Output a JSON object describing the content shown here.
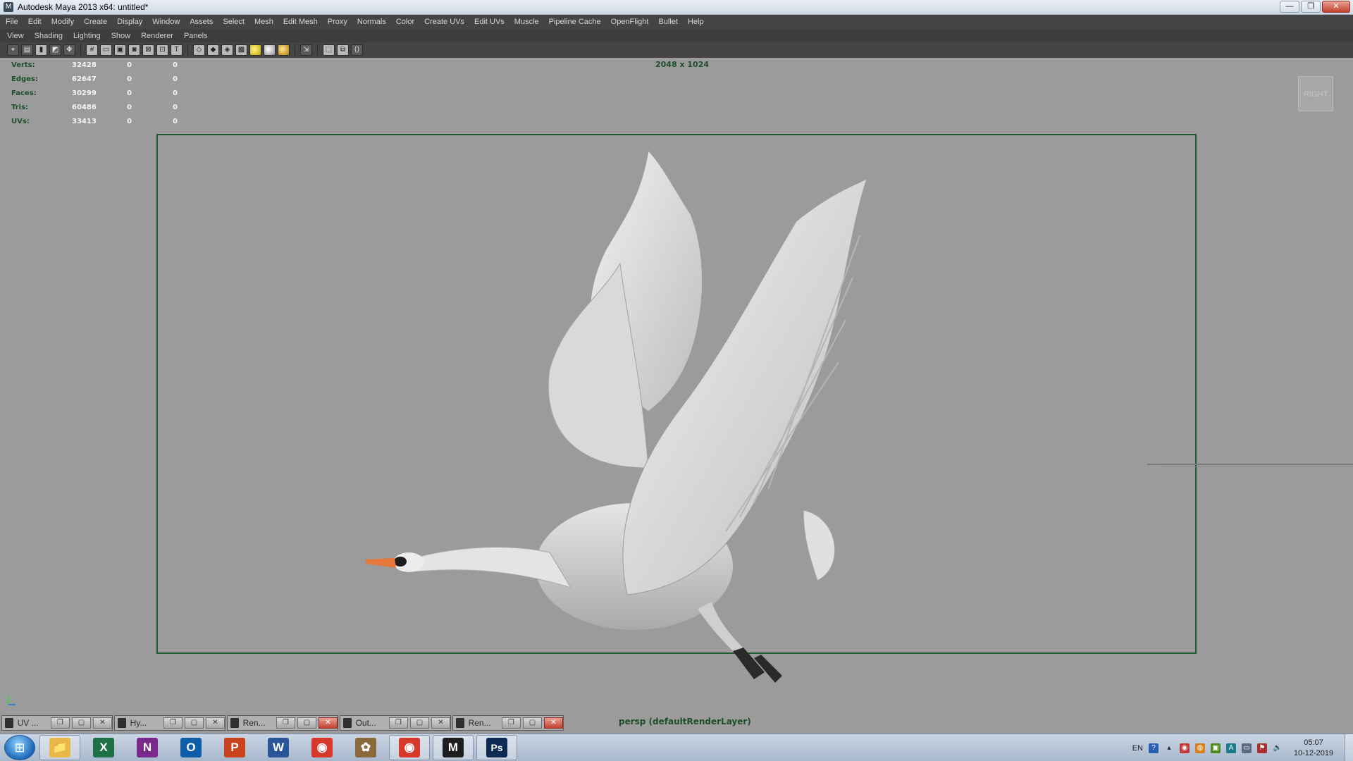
{
  "window": {
    "title": "Autodesk Maya 2013 x64: untitled*",
    "controls": {
      "minimize": "—",
      "restore": "❐",
      "close": "✕"
    }
  },
  "menubar": [
    "File",
    "Edit",
    "Modify",
    "Create",
    "Display",
    "Window",
    "Assets",
    "Select",
    "Mesh",
    "Edit Mesh",
    "Proxy",
    "Normals",
    "Color",
    "Create UVs",
    "Edit UVs",
    "Muscle",
    "Pipeline Cache",
    "OpenFlight",
    "Bullet",
    "Help"
  ],
  "panel_menu": [
    "View",
    "Shading",
    "Lighting",
    "Show",
    "Renderer",
    "Panels"
  ],
  "toolbar_icons": [
    "camera-select-icon",
    "camera-attributes-icon",
    "bookmark-icon",
    "image-plane-icon",
    "2d-pan-icon",
    "grid-icon",
    "film-gate-icon",
    "resolution-gate-icon",
    "gate-mask-icon",
    "field-chart-icon",
    "safe-action-icon",
    "safe-title-icon",
    "wireframe-icon",
    "smooth-shade-icon",
    "shade-wireframe-icon",
    "textured-icon",
    "default-lighting-icon",
    "all-lights-icon",
    "shadows-icon",
    "isolate-select-icon",
    "xray-icon",
    "xray-joints-icon",
    "hypershade-icon"
  ],
  "hud": {
    "rows": [
      {
        "label": "Verts:",
        "v1": "32428",
        "v2": "0",
        "v3": "0"
      },
      {
        "label": "Edges:",
        "v1": "62647",
        "v2": "0",
        "v3": "0"
      },
      {
        "label": "Faces:",
        "v1": "30299",
        "v2": "0",
        "v3": "0"
      },
      {
        "label": "Tris:",
        "v1": "60486",
        "v2": "0",
        "v3": "0"
      },
      {
        "label": "UVs:",
        "v1": "33413",
        "v2": "0",
        "v3": "0"
      }
    ],
    "resolution": "2048 x 1024",
    "viewcube": "RIGHT",
    "camera_label": "persp (defaultRenderLayer)"
  },
  "minimized_panels": [
    {
      "label": "UV ...",
      "close_red": false
    },
    {
      "label": "Hy...",
      "close_red": false
    },
    {
      "label": "Ren...",
      "close_red": true
    },
    {
      "label": "Out...",
      "close_red": false
    },
    {
      "label": "Ren...",
      "close_red": true
    }
  ],
  "taskbar": {
    "apps": [
      {
        "name": "explorer",
        "glyph": "📁",
        "color": "#e8b94a"
      },
      {
        "name": "excel",
        "glyph": "X",
        "color": "#1e7145"
      },
      {
        "name": "onenote",
        "glyph": "N",
        "color": "#7a2a8c"
      },
      {
        "name": "outlook",
        "glyph": "O",
        "color": "#0f5fa8"
      },
      {
        "name": "powerpoint",
        "glyph": "P",
        "color": "#c9431f"
      },
      {
        "name": "word",
        "glyph": "W",
        "color": "#2a5699"
      },
      {
        "name": "chrome",
        "glyph": "◉",
        "color": "#d6392c"
      },
      {
        "name": "gimp",
        "glyph": "✿",
        "color": "#8a6a3a"
      },
      {
        "name": "chrome-active",
        "glyph": "◉",
        "color": "#d6392c"
      },
      {
        "name": "maya",
        "glyph": "M",
        "color": "#1e1e1e"
      },
      {
        "name": "photoshop",
        "glyph": "Ps",
        "color": "#0d2a53"
      }
    ],
    "tray": {
      "language": "EN",
      "time": "05:07",
      "date": "10-12-2019"
    }
  }
}
